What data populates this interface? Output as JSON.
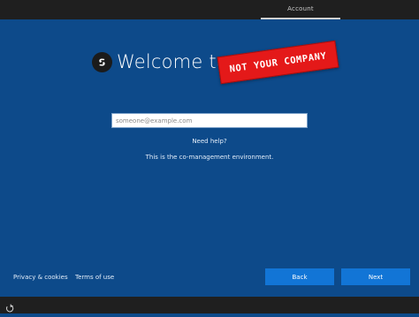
{
  "topbar": {
    "tab_label": "Account"
  },
  "header": {
    "title": "Welcome to",
    "overlay_label": "NOT YOUR COMPANY",
    "logo_icon": "company-logo-icon"
  },
  "form": {
    "email_placeholder": "someone@example.com",
    "email_value": ""
  },
  "help": {
    "need_help": "Need help?",
    "environment_text": "This is the co-management environment."
  },
  "footer": {
    "privacy_label": "Privacy & cookies",
    "terms_label": "Terms of use",
    "back_label": "Back",
    "next_label": "Next"
  },
  "bottombar": {
    "accessibility_icon": "ease-of-access-icon"
  },
  "colors": {
    "background": "#0d4a8a",
    "button": "#1275d6",
    "banner": "#e41919",
    "bar": "#1f1f1f"
  }
}
